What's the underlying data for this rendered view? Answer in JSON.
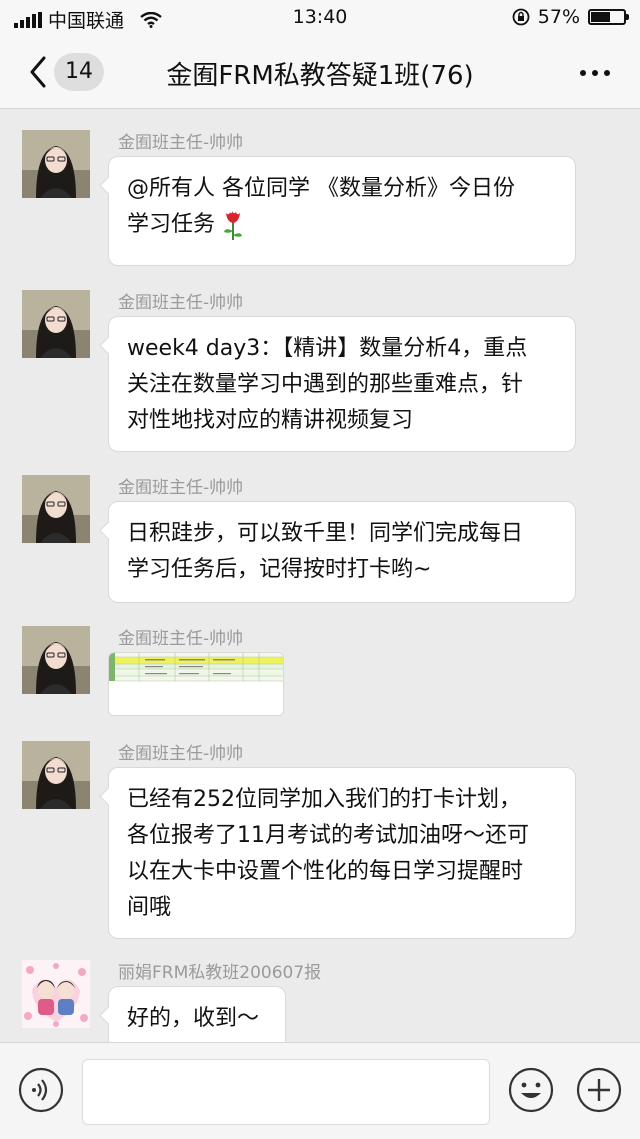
{
  "status_bar": {
    "carrier": "中国联通",
    "time": "13:40",
    "battery": "57%",
    "battery_level": 0.57
  },
  "nav": {
    "back_badge": "14",
    "title": "金囿FRM私教答疑1班(76)"
  },
  "messages": [
    {
      "sender": "金囿班主任-帅帅",
      "lines": [
        "@所有人 各位同学 《数量分析》今日份",
        "学习任务"
      ],
      "emoji": "rose"
    },
    {
      "sender": "金囿班主任-帅帅",
      "lines": [
        "week4 day3：【精讲】数量分析4，重点",
        "关注在数量学习中遇到的那些重难点，针",
        "对性地找对应的精讲视频复习"
      ]
    },
    {
      "sender": "金囿班主任-帅帅",
      "lines": [
        "日积跬步，可以致千里！同学们完成每日",
        "学习任务后，记得按时打卡哟~"
      ]
    },
    {
      "sender": "金囿班主任-帅帅",
      "image": "spreadsheet-thumbnail"
    },
    {
      "sender": "金囿班主任-帅帅",
      "lines": [
        "已经有252位同学加入我们的打卡计划，",
        "各位报考了11月考试的考试加油呀～还可",
        "以在大卡中设置个性化的每日学习提醒时",
        "间哦"
      ]
    },
    {
      "sender": "丽娟FRM私教班200607报",
      "lines": [
        "好的，收到～"
      ]
    }
  ],
  "input_bar": {
    "voice_icon": "voice-icon",
    "emoji_icon": "emoji-icon",
    "plus_icon": "plus-icon",
    "input_value": ""
  }
}
